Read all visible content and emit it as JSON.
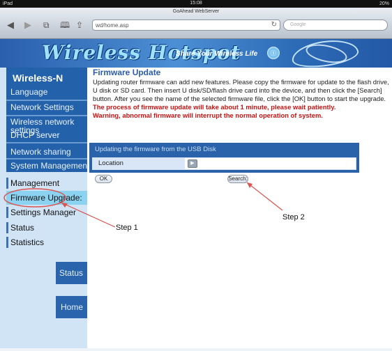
{
  "status_bar": {
    "carrier": "iPad",
    "time": "15:08",
    "battery": "20%"
  },
  "browser": {
    "page_title": "GoAhead WebServer",
    "address": "wd/home.asp",
    "search_placeholder": "Google",
    "back_icon": "back-arrow-icon",
    "forward_icon": "forward-arrow-icon"
  },
  "banner": {
    "title": "Wireless Hotspot",
    "subtitle": "Share Your Wireless Life"
  },
  "sidebar": {
    "brand": "Wireless-N",
    "top_items": [
      {
        "label": "Language"
      },
      {
        "label": "Network Settings"
      },
      {
        "label": "Wireless network"
      },
      {
        "label": "settings"
      },
      {
        "label": "DHCP server"
      },
      {
        "label": "Network sharing"
      },
      {
        "label": "System Management"
      }
    ],
    "sub_items": [
      {
        "label": "Management"
      },
      {
        "label": "Firmware Upgrade:"
      },
      {
        "label": "Settings Manager"
      },
      {
        "label": "Status"
      },
      {
        "label": "Statistics"
      }
    ],
    "status_button": "Status",
    "home_button": "Home"
  },
  "main": {
    "title": "Firmware Update",
    "description": "Updating router firmware can add new features. Please copy the firmware for update to the flash drive, U disk or SD card. Then insert U disk/SD/flash drive card into the device, and then click the [Search] button. After you see the name of the selected firmware file, click the [OK] button to start the upgrade.",
    "warning_1": "The process of firmware update will take about 1 minute, please wait patiently.",
    "warning_2": "Warning, abnormal firmware will interrupt the normal operation of system.",
    "usb_header": "Updating the firmware from the USB Disk",
    "location_label": "Location",
    "ok_label": "OK",
    "search_label": "Search:"
  },
  "annotations": {
    "step1": "Step 1",
    "step2": "Step 2",
    "color": "#d9534f"
  }
}
